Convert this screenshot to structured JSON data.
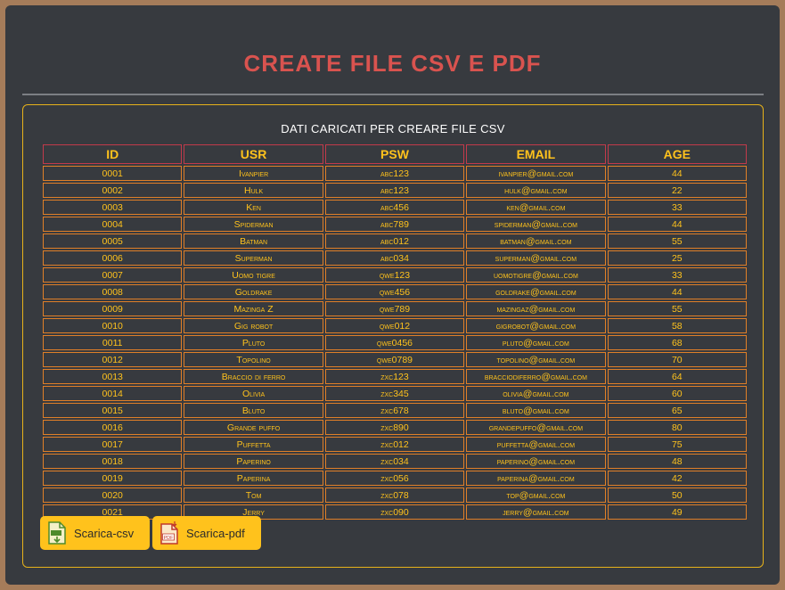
{
  "title": "CREATE FILE CSV E PDF",
  "table": {
    "caption": "DATI CARICATI PER CREARE FILE CSV",
    "headers": [
      "ID",
      "USR",
      "PSW",
      "EMAIL",
      "AGE"
    ],
    "rows": [
      [
        "0001",
        "Ivanpier",
        "abc123",
        "ivanpier@gmail.com",
        "44"
      ],
      [
        "0002",
        "Hulk",
        "abc123",
        "hulk@gmail.com",
        "22"
      ],
      [
        "0003",
        "Ken",
        "abc456",
        "ken@gmail.com",
        "33"
      ],
      [
        "0004",
        "Spiderman",
        "abc789",
        "spiderman@gmail.com",
        "44"
      ],
      [
        "0005",
        "Batman",
        "abc012",
        "batman@gmail.com",
        "55"
      ],
      [
        "0006",
        "Superman",
        "abc034",
        "superman@gmail.com",
        "25"
      ],
      [
        "0007",
        "Uomo tigre",
        "qwe123",
        "uomotigre@gmail.com",
        "33"
      ],
      [
        "0008",
        "Goldrake",
        "qwe456",
        "goldrake@gmail.com",
        "44"
      ],
      [
        "0009",
        "Mazinga Z",
        "qwe789",
        "mazingaz@gmail.com",
        "55"
      ],
      [
        "0010",
        "Gig robot",
        "qwe012",
        "gigrobot@gmail.com",
        "58"
      ],
      [
        "0011",
        "Pluto",
        "qwe0456",
        "pluto@gmail.com",
        "68"
      ],
      [
        "0012",
        "Topolino",
        "qwe0789",
        "topolino@gmail.com",
        "70"
      ],
      [
        "0013",
        "Braccio di ferro",
        "zxc123",
        "bracciodiferro@gmail.com",
        "64"
      ],
      [
        "0014",
        "Olivia",
        "zxc345",
        "olivia@gmail.com",
        "60"
      ],
      [
        "0015",
        "Bluto",
        "zxc678",
        "bluto@gmail.com",
        "65"
      ],
      [
        "0016",
        "Grande puffo",
        "zxc890",
        "grandepuffo@gmail.com",
        "80"
      ],
      [
        "0017",
        "Puffetta",
        "zxc012",
        "puffetta@gmail.com",
        "75"
      ],
      [
        "0018",
        "Paperino",
        "zxc034",
        "paperino@gmail.com",
        "48"
      ],
      [
        "0019",
        "Paperina",
        "zxc056",
        "paperina@gmail.com",
        "42"
      ],
      [
        "0020",
        "Tom",
        "zxc078",
        "top@gmail.com",
        "50"
      ],
      [
        "0021",
        "Jerry",
        "zxc090",
        "jerry@gmail.com",
        "49"
      ]
    ]
  },
  "buttons": {
    "csv": {
      "label": "Scarica-csv",
      "icon": "csv-file-icon"
    },
    "pdf": {
      "label": "Scarica-pdf",
      "icon": "pdf-file-icon"
    }
  },
  "colors": {
    "background": "#373a3f",
    "title": "#d9534f",
    "accent": "#ffc21c",
    "header_border": "#c23a4b",
    "cell_border": "#e07f28"
  }
}
